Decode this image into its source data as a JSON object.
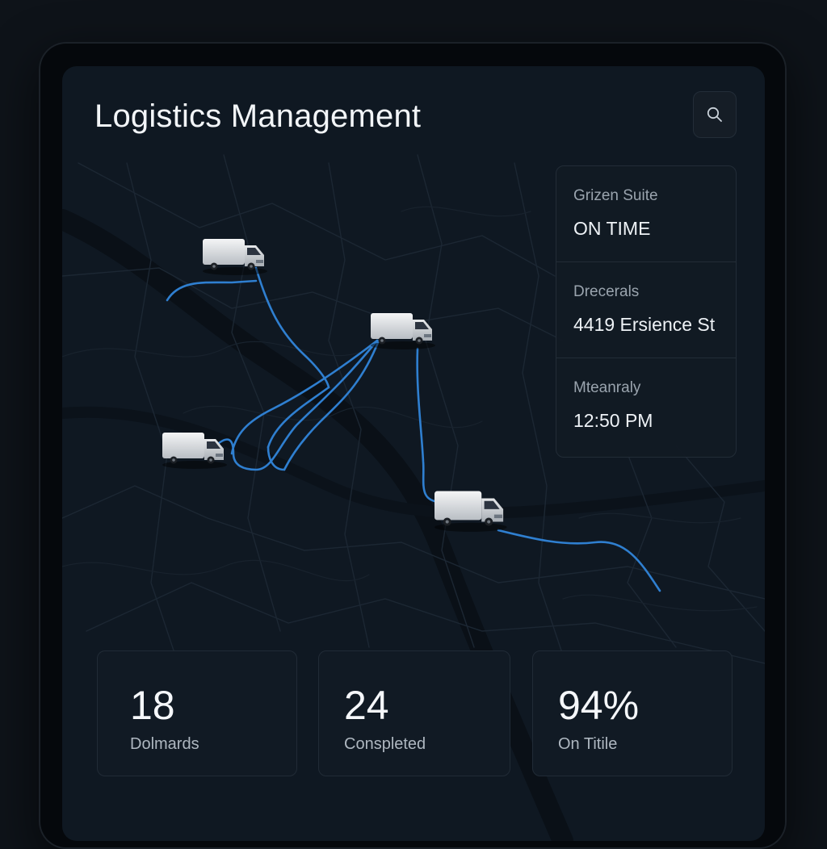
{
  "header": {
    "title": "Logistics Management",
    "search_icon": "search-icon"
  },
  "map": {
    "route_color": "#2f7fd0",
    "vehicles": [
      {
        "icon": "truck-icon"
      },
      {
        "icon": "truck-icon"
      },
      {
        "icon": "truck-icon"
      },
      {
        "icon": "truck-icon"
      }
    ]
  },
  "info_panel": {
    "rows": [
      {
        "label": "Grizen Suite",
        "value": "ON TIME"
      },
      {
        "label": "Drecerals",
        "value": "4419 Ersience St"
      },
      {
        "label": "Mteanraly",
        "value": "12:50 PM"
      }
    ]
  },
  "stats": [
    {
      "value": "18",
      "label": "Dolmards"
    },
    {
      "value": "24",
      "label": "Conspleted"
    },
    {
      "value": "94%",
      "label": "On Titile"
    }
  ],
  "colors": {
    "background": "#0f1822",
    "card": "#111a24",
    "route": "#2f7fd0",
    "text": "#f2f5f8"
  }
}
